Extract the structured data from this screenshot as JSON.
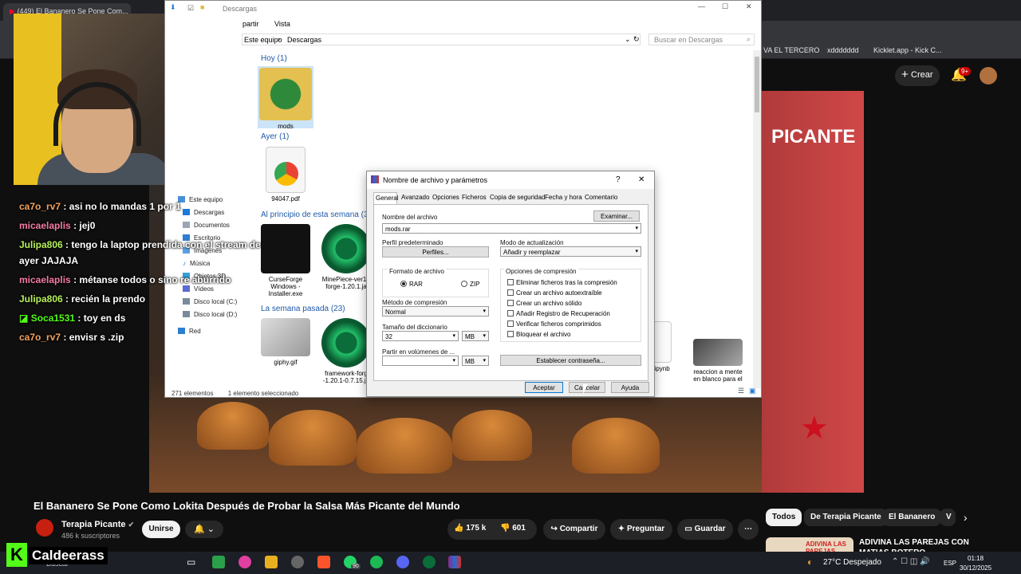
{
  "browser": {
    "tab_title": "(449) El Bananero Se Pone Com...",
    "bookmarks": [
      "VA EL TERCERO",
      "xddddddd",
      "Kicklet.app - Kick C..."
    ]
  },
  "youtube": {
    "create_label": "Crear",
    "notifications_badge": "9+",
    "video_overlay_text": "PICANTE",
    "video_title": "El Bananero Se Pone Como Lokita Después de Probar la Salsa Más Picante del Mundo",
    "channel_name": "Terapia Picante",
    "subscribers": "486 k suscriptores",
    "subscribe_label": "Unirse",
    "likes": "175 k",
    "dislikes": "601",
    "share_label": "Compartir",
    "ask_label": "Preguntar",
    "save_label": "Guardar",
    "chips": [
      "Todos",
      "De Terapia Picante",
      "El Bananero",
      "V"
    ],
    "recommended_title": "ADIVINA LAS PAREJAS CON MATIAS BOTERO",
    "recommended_thumb_text": "ADIVINA LAS PAREJAS"
  },
  "chat": [
    {
      "user": "ca7o_rv7",
      "text": ": asi no lo mandas 1 por 1",
      "color": "#f5a25d"
    },
    {
      "user": "micaelaplis",
      "text": ": jej0",
      "color": "#f57ba6"
    },
    {
      "user": "Julipa806",
      "text": ": tengo la laptop prendida con el stream de",
      "color": "#b6f05a"
    },
    {
      "user": "",
      "text": "ayer JAJAJA",
      "color": "#ffffff"
    },
    {
      "user": "micaelaplis",
      "text": ": métanse todos o sino re aburrido",
      "color": "#f57ba6"
    },
    {
      "user": "Julipa806",
      "text": ": recién la prendo",
      "color": "#b6f05a"
    },
    {
      "user": "Soca1531",
      "text": ": toy en ds",
      "color": "#53fc18"
    },
    {
      "user": "ca7o_rv7",
      "text": ": envisr s .zip",
      "color": "#f5a25d"
    }
  ],
  "explorer": {
    "title": "Descargas",
    "ribbon": [
      "partir",
      "Vista"
    ],
    "breadcrumb": [
      "Este equipo",
      "Descargas"
    ],
    "search_placeholder": "Buscar en Descargas",
    "groups": {
      "today": "Hoy (1)",
      "yesterday": "Ayer (1)",
      "month": "Al principio de esta semana (3",
      "last_week": "La semana pasada (23)"
    },
    "files": {
      "mods": "mods",
      "pdf": "94047.pdf",
      "curseforge": "CurseForge Windows - Installer.exe",
      "minepiece": "MinePiece-ver1 -forge-1.20.1.ja",
      "giphy": "giphy.gif",
      "framework": "framework-forg -1.20.1-0.7.15.ja",
      "ipynb": "ck.ipynb",
      "reaccion": "reaccion a mente en blanco para el"
    },
    "nav": [
      "Este equipo",
      "Descargas",
      "Documentos",
      "Escritorio",
      "Imágenes",
      "Música",
      "Objetos 3D",
      "Vídeos",
      "Disco local (C:)",
      "Disco local (D:)",
      "Red"
    ],
    "status_count": "271 elementos",
    "status_selected": "1 elemento seleccionado"
  },
  "dialog": {
    "title": "Nombre de archivo y parámetros",
    "help": "?",
    "close": "✕",
    "tabs": [
      "General",
      "Avanzado",
      "Opciones",
      "Ficheros",
      "Copia de seguridad",
      "Fecha y hora",
      "Comentario"
    ],
    "archive_name_label": "Nombre del archivo",
    "archive_name_value": "mods.rar",
    "browse_label": "Examinar...",
    "profile_label": "Perfil predeterminado",
    "profiles_button": "Perfiles...",
    "update_mode_label": "Modo de actualización",
    "update_mode_value": "Añadir y reemplazar",
    "format_label": "Formato de archivo",
    "format_rar": "RAR",
    "format_zip": "ZIP",
    "compression_options_label": "Opciones de compresión",
    "compression_options": [
      "Eliminar ficheros tras la compresión",
      "Crear un archivo autoextraíble",
      "Crear un archivo sólido",
      "Añadir Registro de Recuperación",
      "Verificar ficheros comprimidos",
      "Bloquear el archivo"
    ],
    "method_label": "Método de compresión",
    "method_value": "Normal",
    "dict_label": "Tamaño del diccionario",
    "dict_value": "32",
    "dict_unit": "MB",
    "split_label": "Partir en volúmenes de ...",
    "split_value": "",
    "split_unit": "MB",
    "password_button": "Establecer contraseña...",
    "ok_button": "Aceptar",
    "cancel_button": "Cancelar",
    "help_button": "Ayuda"
  },
  "taskbar": {
    "kick_logo": "K",
    "kick_name": "Caldeerass",
    "search_text": "Buscar",
    "whatsapp_badge": "90",
    "weather": "27°C  Despejado",
    "language": "ESP",
    "time": "01:18",
    "date": "30/12/2025"
  }
}
